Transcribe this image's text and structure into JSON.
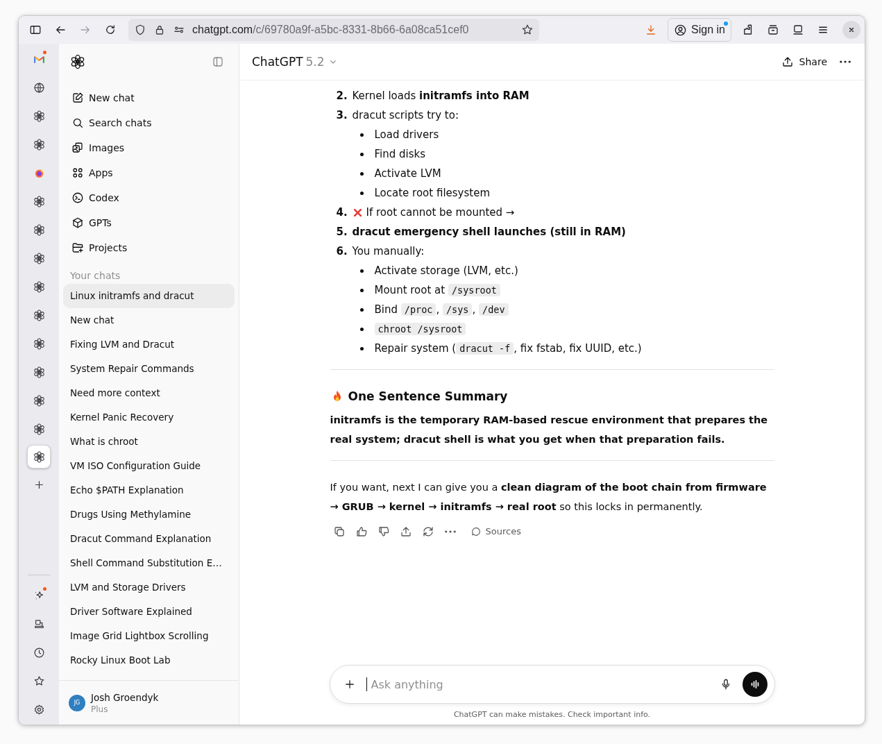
{
  "browser": {
    "url_host": "chatgpt.com",
    "url_path": "/c/69780a9f-a5bc-8331-8b66-6a08ca51cef0",
    "sign_in": "Sign in"
  },
  "rail": {
    "apps": [
      {
        "kind": "mail",
        "selected": false,
        "badge": true
      },
      {
        "kind": "globe",
        "selected": false,
        "badge": false
      },
      {
        "kind": "chatgpt",
        "selected": false,
        "badge": false
      },
      {
        "kind": "chatgpt",
        "selected": false,
        "badge": false
      },
      {
        "kind": "firefox",
        "selected": false,
        "badge": false
      },
      {
        "kind": "chatgpt",
        "selected": false,
        "badge": false
      },
      {
        "kind": "chatgpt",
        "selected": false,
        "badge": false
      },
      {
        "kind": "chatgpt",
        "selected": false,
        "badge": false
      },
      {
        "kind": "chatgpt",
        "selected": false,
        "badge": false
      },
      {
        "kind": "chatgpt",
        "selected": false,
        "badge": false
      },
      {
        "kind": "chatgpt",
        "selected": false,
        "badge": false
      },
      {
        "kind": "chatgpt",
        "selected": false,
        "badge": false
      },
      {
        "kind": "chatgpt",
        "selected": false,
        "badge": false
      },
      {
        "kind": "chatgpt",
        "selected": false,
        "badge": false
      },
      {
        "kind": "chatgpt",
        "selected": true,
        "badge": false
      }
    ],
    "tools": [
      {
        "kind": "sparkle",
        "badge": true
      },
      {
        "kind": "device",
        "badge": false
      },
      {
        "kind": "clock",
        "badge": false
      },
      {
        "kind": "star",
        "badge": false
      },
      {
        "kind": "gear",
        "badge": false
      }
    ]
  },
  "sidebar": {
    "nav": [
      {
        "kind": "new",
        "label": "New chat"
      },
      {
        "kind": "search",
        "label": "Search chats"
      },
      {
        "kind": "images",
        "label": "Images"
      },
      {
        "kind": "apps",
        "label": "Apps"
      },
      {
        "kind": "codex",
        "label": "Codex"
      },
      {
        "kind": "gpts",
        "label": "GPTs"
      },
      {
        "kind": "projects",
        "label": "Projects"
      }
    ],
    "section_title": "Your chats",
    "chats": [
      {
        "label": "Linux initramfs and dracut",
        "selected": true
      },
      {
        "label": "New chat",
        "selected": false
      },
      {
        "label": "Fixing LVM and Dracut",
        "selected": false
      },
      {
        "label": "System Repair Commands",
        "selected": false
      },
      {
        "label": "Need more context",
        "selected": false
      },
      {
        "label": "Kernel Panic Recovery",
        "selected": false
      },
      {
        "label": "What is chroot",
        "selected": false
      },
      {
        "label": "VM ISO Configuration Guide",
        "selected": false
      },
      {
        "label": "Echo $PATH Explanation",
        "selected": false
      },
      {
        "label": "Drugs Using Methylamine",
        "selected": false
      },
      {
        "label": "Dracut Command Explanation",
        "selected": false
      },
      {
        "label": "Shell Command Substitution E…",
        "selected": false
      },
      {
        "label": "LVM and Storage Drivers",
        "selected": false
      },
      {
        "label": "Driver Software Explained",
        "selected": false
      },
      {
        "label": "Image Grid Lightbox Scrolling",
        "selected": false
      },
      {
        "label": "Rocky Linux Boot Lab",
        "selected": false
      }
    ],
    "user": {
      "initials": "JG",
      "name": "Josh Groendyk",
      "plan": "Plus"
    }
  },
  "header": {
    "model": "ChatGPT",
    "version": "5.2",
    "share": "Share"
  },
  "message": {
    "steps": [
      {
        "number": "2.",
        "kind": "plain",
        "parts": [
          {
            "kind": "text",
            "text": "Kernel loads "
          },
          {
            "kind": "bold",
            "text": "initramfs into RAM"
          }
        ]
      },
      {
        "number": "3.",
        "kind": "plain",
        "parts": [
          {
            "kind": "text",
            "text": "dracut scripts try to:"
          }
        ],
        "bullets": [
          [
            {
              "kind": "text",
              "text": "Load drivers"
            }
          ],
          [
            {
              "kind": "text",
              "text": "Find disks"
            }
          ],
          [
            {
              "kind": "text",
              "text": "Activate LVM"
            }
          ],
          [
            {
              "kind": "text",
              "text": "Locate root filesystem"
            }
          ]
        ]
      },
      {
        "number": "4.",
        "kind": "failure",
        "parts": [
          {
            "kind": "text",
            "text": "If root cannot be mounted →"
          }
        ]
      },
      {
        "number": "5.",
        "kind": "plain",
        "parts": [
          {
            "kind": "bold",
            "text": "dracut emergency shell launches (still in RAM)"
          }
        ]
      },
      {
        "number": "6.",
        "kind": "plain",
        "parts": [
          {
            "kind": "text",
            "text": "You manually:"
          }
        ],
        "bullets": [
          [
            {
              "kind": "text",
              "text": "Activate storage (LVM, etc.)"
            }
          ],
          [
            {
              "kind": "text",
              "text": "Mount root at "
            },
            {
              "kind": "code",
              "text": "/sysroot"
            }
          ],
          [
            {
              "kind": "text",
              "text": "Bind "
            },
            {
              "kind": "code",
              "text": "/proc"
            },
            {
              "kind": "text",
              "text": ", "
            },
            {
              "kind": "code",
              "text": "/sys"
            },
            {
              "kind": "text",
              "text": ", "
            },
            {
              "kind": "code",
              "text": "/dev"
            }
          ],
          [
            {
              "kind": "code",
              "text": "chroot /sysroot"
            }
          ],
          [
            {
              "kind": "text",
              "text": "Repair system ("
            },
            {
              "kind": "code",
              "text": "dracut -f"
            },
            {
              "kind": "text",
              "text": ", fix fstab, fix UUID, etc.)"
            }
          ]
        ]
      }
    ],
    "summary_title": "One Sentence Summary",
    "summary": "initramfs is the temporary RAM-based rescue environment that prepares the real system; dracut shell is what you get when that preparation fails.",
    "followup": "If you want, next I can give you a **clean diagram of the boot chain from firmware → GRUB → kernel → initramfs → real root** so this locks in permanently.",
    "sources": "Sources"
  },
  "composer": {
    "placeholder": "Ask anything"
  },
  "disclaimer": "ChatGPT can make mistakes. Check important info."
}
